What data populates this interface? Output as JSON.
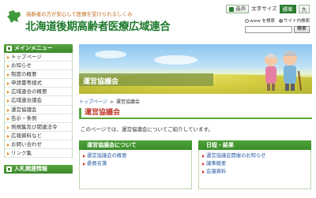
{
  "header": {
    "tagline": "高齢者の方が安心して医療を受けられるしくみ",
    "title": "北海道後期高齢者医療広域連合",
    "voice_label": "音声",
    "font_size_label": "文字サイズ",
    "size_normal": "標準",
    "size_large": "大",
    "search": {
      "option_web": "www を検索",
      "option_site": "サイト内検索",
      "button": "検索",
      "placeholder": ""
    }
  },
  "sidebar": {
    "menu_title": "メインメニュー",
    "items": [
      "トップページ",
      "お知らせ",
      "制度の概要",
      "申請書等様式",
      "広域連合の概要",
      "広域連合議会",
      "運営協議会",
      "告示・条例",
      "例規集及び関連法令",
      "広報資料など",
      "お問い合わせ",
      "リンク集"
    ],
    "second_title": "入札関連情報"
  },
  "main": {
    "banner_title": "運営協議会",
    "breadcrumb": {
      "home": "トップページ",
      "separator": ">",
      "current": "運営協議会"
    },
    "heading": "運営協議会",
    "intro": "このページでは、運営協議会についてご紹介しています。",
    "panels": [
      {
        "title": "運営協議会について",
        "links": [
          "運営協議会の概要",
          "委員名簿"
        ]
      },
      {
        "title": "日程・結果",
        "links": [
          "運営協議会開催のお知らせ",
          "議事概要",
          "会議資料"
        ]
      }
    ]
  },
  "colors": {
    "brand_green": "#2d7d33",
    "heading_red": "#c0392b",
    "link_blue": "#2c5fa8",
    "accent_orange": "#e08a1e"
  }
}
